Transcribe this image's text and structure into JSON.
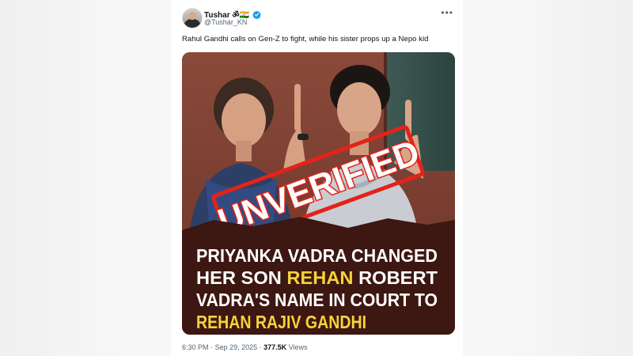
{
  "tweet": {
    "author_name": "Tushar ॐ🇮🇳",
    "handle": "@Tushar_KN",
    "text": "Rahul Gandhi calls on Gen-Z to fight, while his sister props up a Nepo kid",
    "more_icon": "more-horizontal-icon",
    "verified_icon": "verified-badge-icon"
  },
  "media": {
    "stamp_text": "UNVERIFIED",
    "stamp_color": "#e2231a",
    "headline_lines": [
      [
        {
          "text": "PRIYANKA VADRA CHANGED",
          "highlight": false
        }
      ],
      [
        {
          "text": "HER SON ",
          "highlight": false
        },
        {
          "text": "REHAN",
          "highlight": true
        },
        {
          "text": " ROBERT",
          "highlight": false
        }
      ],
      [
        {
          "text": "VADRA'S NAME IN COURT TO",
          "highlight": false
        }
      ],
      [
        {
          "text": "REHAN RAJIV GANDHI",
          "highlight": true
        }
      ]
    ],
    "headline_color": "#ffffff",
    "highlight_color": "#f5d33a",
    "banner_color": "#3d1711"
  },
  "footer": {
    "time": "6:30 PM",
    "separator": "·",
    "date": "Sep 29, 2025",
    "views_count": "377.5K",
    "views_label": "Views"
  }
}
